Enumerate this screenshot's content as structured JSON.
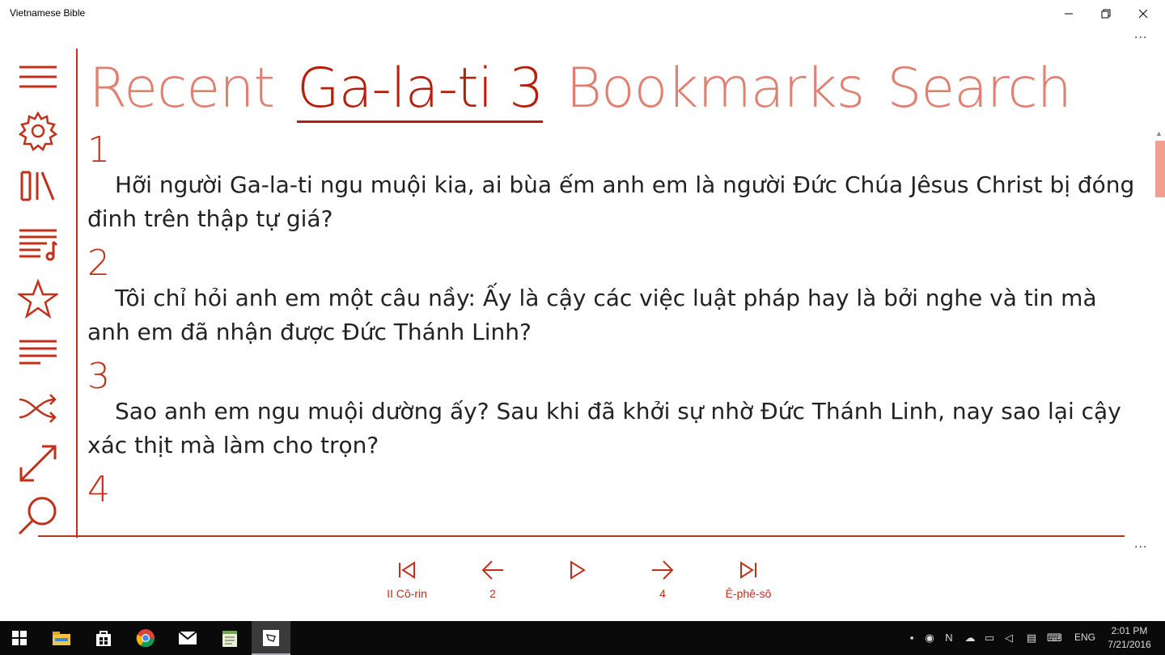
{
  "window": {
    "title": "Vietnamese Bible"
  },
  "pivot": {
    "items": [
      {
        "label": "Recent",
        "active": false
      },
      {
        "label": "Ga-la-ti 3",
        "active": true
      },
      {
        "label": "Bookmarks",
        "active": false
      },
      {
        "label": "Search",
        "active": false
      }
    ]
  },
  "rail": {
    "icons": [
      "hamburger-menu-icon",
      "gear-icon",
      "library-icon",
      "playlist-music-icon",
      "star-icon",
      "text-lines-icon",
      "shuffle-icon",
      "expand-diagonal-icon",
      "search-icon"
    ]
  },
  "verses": [
    {
      "number": "1",
      "text": "Hỡi người Ga-la-ti ngu muội kia, ai bùa ếm anh em là người Đức Chúa Jêsus Christ bị đóng đinh trên thập tự giá?"
    },
    {
      "number": "2",
      "text": "Tôi chỉ hỏi anh em một câu nầy: Ấy là cậy các việc luật pháp hay là bởi nghe và tin mà anh em đã nhận được Đức Thánh Linh?"
    },
    {
      "number": "3",
      "text": "Sao anh em ngu muội dường ấy? Sau khi đã khởi sự nhờ Đức Thánh Linh, nay sao lại cậy xác thịt mà làm cho trọn?"
    },
    {
      "number": "4",
      "text": ""
    }
  ],
  "nav": {
    "first_label": "II Cô-rin",
    "prev_label": "2",
    "play_label": "",
    "next_label": "4",
    "last_label": "Ê-phê-sô"
  },
  "more_glyph": "...",
  "taskbar": {
    "apps": [
      "windows-start-icon",
      "file-explorer-icon",
      "store-icon",
      "chrome-icon",
      "mail-icon",
      "notepad-icon",
      "bible-app-icon"
    ],
    "language": "ENG",
    "time": "2:01 PM",
    "date": "7/21/2016"
  },
  "colors": {
    "accent": "#c0301a",
    "accent_light": "#e08070",
    "text": "#222222"
  }
}
